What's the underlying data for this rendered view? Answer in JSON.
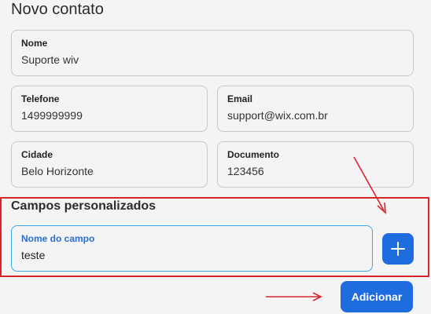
{
  "header": {
    "title": "Novo contato"
  },
  "fields": {
    "nome": {
      "label": "Nome",
      "value": "Suporte wiv"
    },
    "telefone": {
      "label": "Telefone",
      "value": "1499999999"
    },
    "email": {
      "label": "Email",
      "value": "support@wix.com.br"
    },
    "cidade": {
      "label": "Cidade",
      "value": "Belo Horizonte"
    },
    "documento": {
      "label": "Documento",
      "value": "123456"
    }
  },
  "custom_fields": {
    "title": "Campos personalizados",
    "field_label": "Nome do campo",
    "field_value": "teste",
    "add_icon": "plus-icon"
  },
  "actions": {
    "submit_label": "Adicionar"
  },
  "annotations": {
    "color": "#d8252c"
  }
}
